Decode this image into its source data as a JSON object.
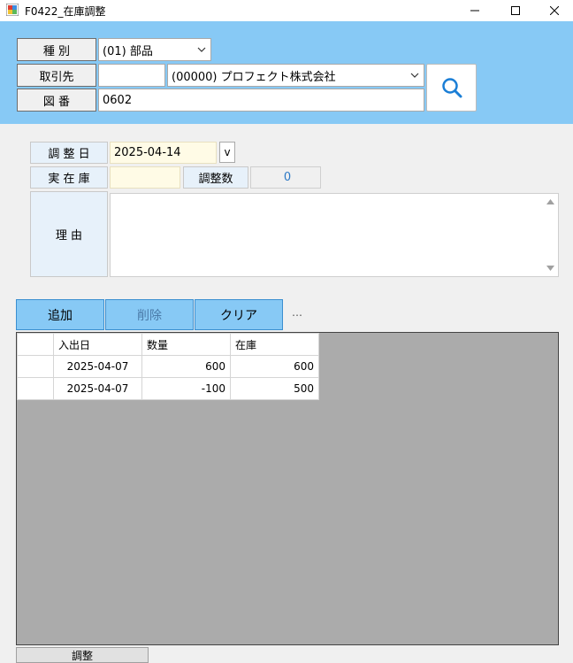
{
  "window": {
    "title": "F0422_在庫調整"
  },
  "header": {
    "kind_label": "種 別",
    "kind_value": "(01) 部品",
    "partner_label": "取引先",
    "partner_code": "",
    "partner_value": "(00000) プロフェクト株式会社",
    "drawing_label": "図 番",
    "drawing_value": "0602"
  },
  "form": {
    "date_label": "調 整 日",
    "date_value": "2025-04-14",
    "date_button": "v",
    "actual_label": "実 在 庫",
    "actual_value": "",
    "adjust_count_label": "調整数",
    "adjust_count_value": "0",
    "reason_label": "理  由",
    "reason_value": ""
  },
  "actions": {
    "add": "追加",
    "delete": "削除",
    "clear": "クリア",
    "more": "…"
  },
  "grid": {
    "columns": [
      "入出日",
      "数量",
      "在庫"
    ],
    "rows": [
      {
        "date": "2025-04-07",
        "qty": "600",
        "stock": "600"
      },
      {
        "date": "2025-04-07",
        "qty": "-100",
        "stock": "500"
      }
    ]
  },
  "footer": {
    "adjust_button": "調整"
  },
  "colors": {
    "panel": "#87c9f5",
    "accent_text": "#2b78c5",
    "date_bg": "#fffbe6"
  }
}
